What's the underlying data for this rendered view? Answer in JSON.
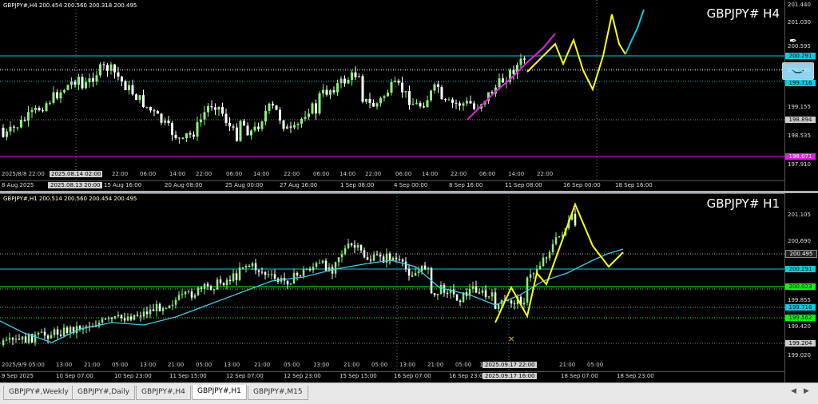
{
  "colors": {
    "bull": "#8cf07a",
    "bear": "#ffffff",
    "cyan": "#00d0e0",
    "yellow": "#ffff00",
    "magenta": "#e020e0",
    "green": "#00ff00"
  },
  "h4": {
    "header": "GBPJPY#,H4  200.454 200.560 200.318 200.495",
    "symbol": "GBPJPY#  H4",
    "ticks": [
      "201.440",
      "201.030",
      "200.595",
      "200.180",
      "199.716",
      "199.155",
      "198.894",
      "198.535",
      "198.071",
      "197.910"
    ],
    "tags": {
      "cyan_top": "200.291",
      "cyan_low": "199.716",
      "magenta": "198.071",
      "grey": "198.894"
    },
    "xlabels": [
      "8 Aug 2025",
      "15 Aug 16:00",
      "20 Aug 08:00",
      "25 Aug 00:00",
      "27 Aug 16:00",
      "1 Sep 08:00",
      "4 Sep 00:00",
      "8 Sep 16:00",
      "11 Sep 08:00",
      "16 Sep 00:00",
      "18 Sep 16:00"
    ],
    "crossx_bottom": "2025.08.13 20:00",
    "toplabels": [
      "2025/8/8 22:00",
      "2025.08.14 02:00",
      "22:00",
      "06:00",
      "14:00",
      "22:00",
      "06:00",
      "14:00",
      "22:00",
      "06:00",
      "14:00",
      "22:00",
      "06:00",
      "14:00",
      "22:00",
      "06:00",
      "14:00",
      "22:00"
    ]
  },
  "h1": {
    "header": "GBPJPY#,H1  200.514 200.560 200.454 200.495",
    "symbol": "GBPJPY#  H1",
    "ticks": [
      "201.105",
      "200.690",
      "200.495",
      "200.291",
      "200.023",
      "199.855",
      "199.716",
      "199.562",
      "199.420",
      "199.204",
      "199.020"
    ],
    "tags": {
      "price": "200.495",
      "cyan": "200.291",
      "green": "200.023",
      "cyan2": "199.716",
      "green2": "199.562",
      "grey": "199.204"
    },
    "xlabels": [
      "9 Sep 2025",
      "10 Sep 07:00",
      "10 Sep 23:00",
      "11 Sep 15:00",
      "12 Sep 07:00",
      "12 Sep 23:00",
      "15 Sep 15:00",
      "16 Sep 07:00",
      "16 Sep 23:00",
      "18 Sep 07:00",
      "18 Sep 23:00"
    ],
    "toplabels": [
      "2025/9/9 05:00",
      "13:00",
      "21:00",
      "05:00",
      "13:00",
      "21:00",
      "05:00",
      "13:00",
      "21:00",
      "05:00",
      "13:00",
      "21:00",
      "05:00",
      "13:00",
      "21:00",
      "05:00",
      "13:00",
      "21:00",
      "05:00"
    ],
    "crossx_top": "2025.09.17 22:00",
    "crossx_bottom": "2025.09.17 16:00"
  },
  "tabs": [
    "GBPJPY#,Weekly",
    "GBPJPY#,Daily",
    "GBPJPY#,H4",
    "GBPJPY#,H1",
    "GBPJPY#,M15"
  ],
  "active_tab": "GBPJPY#,H1"
}
